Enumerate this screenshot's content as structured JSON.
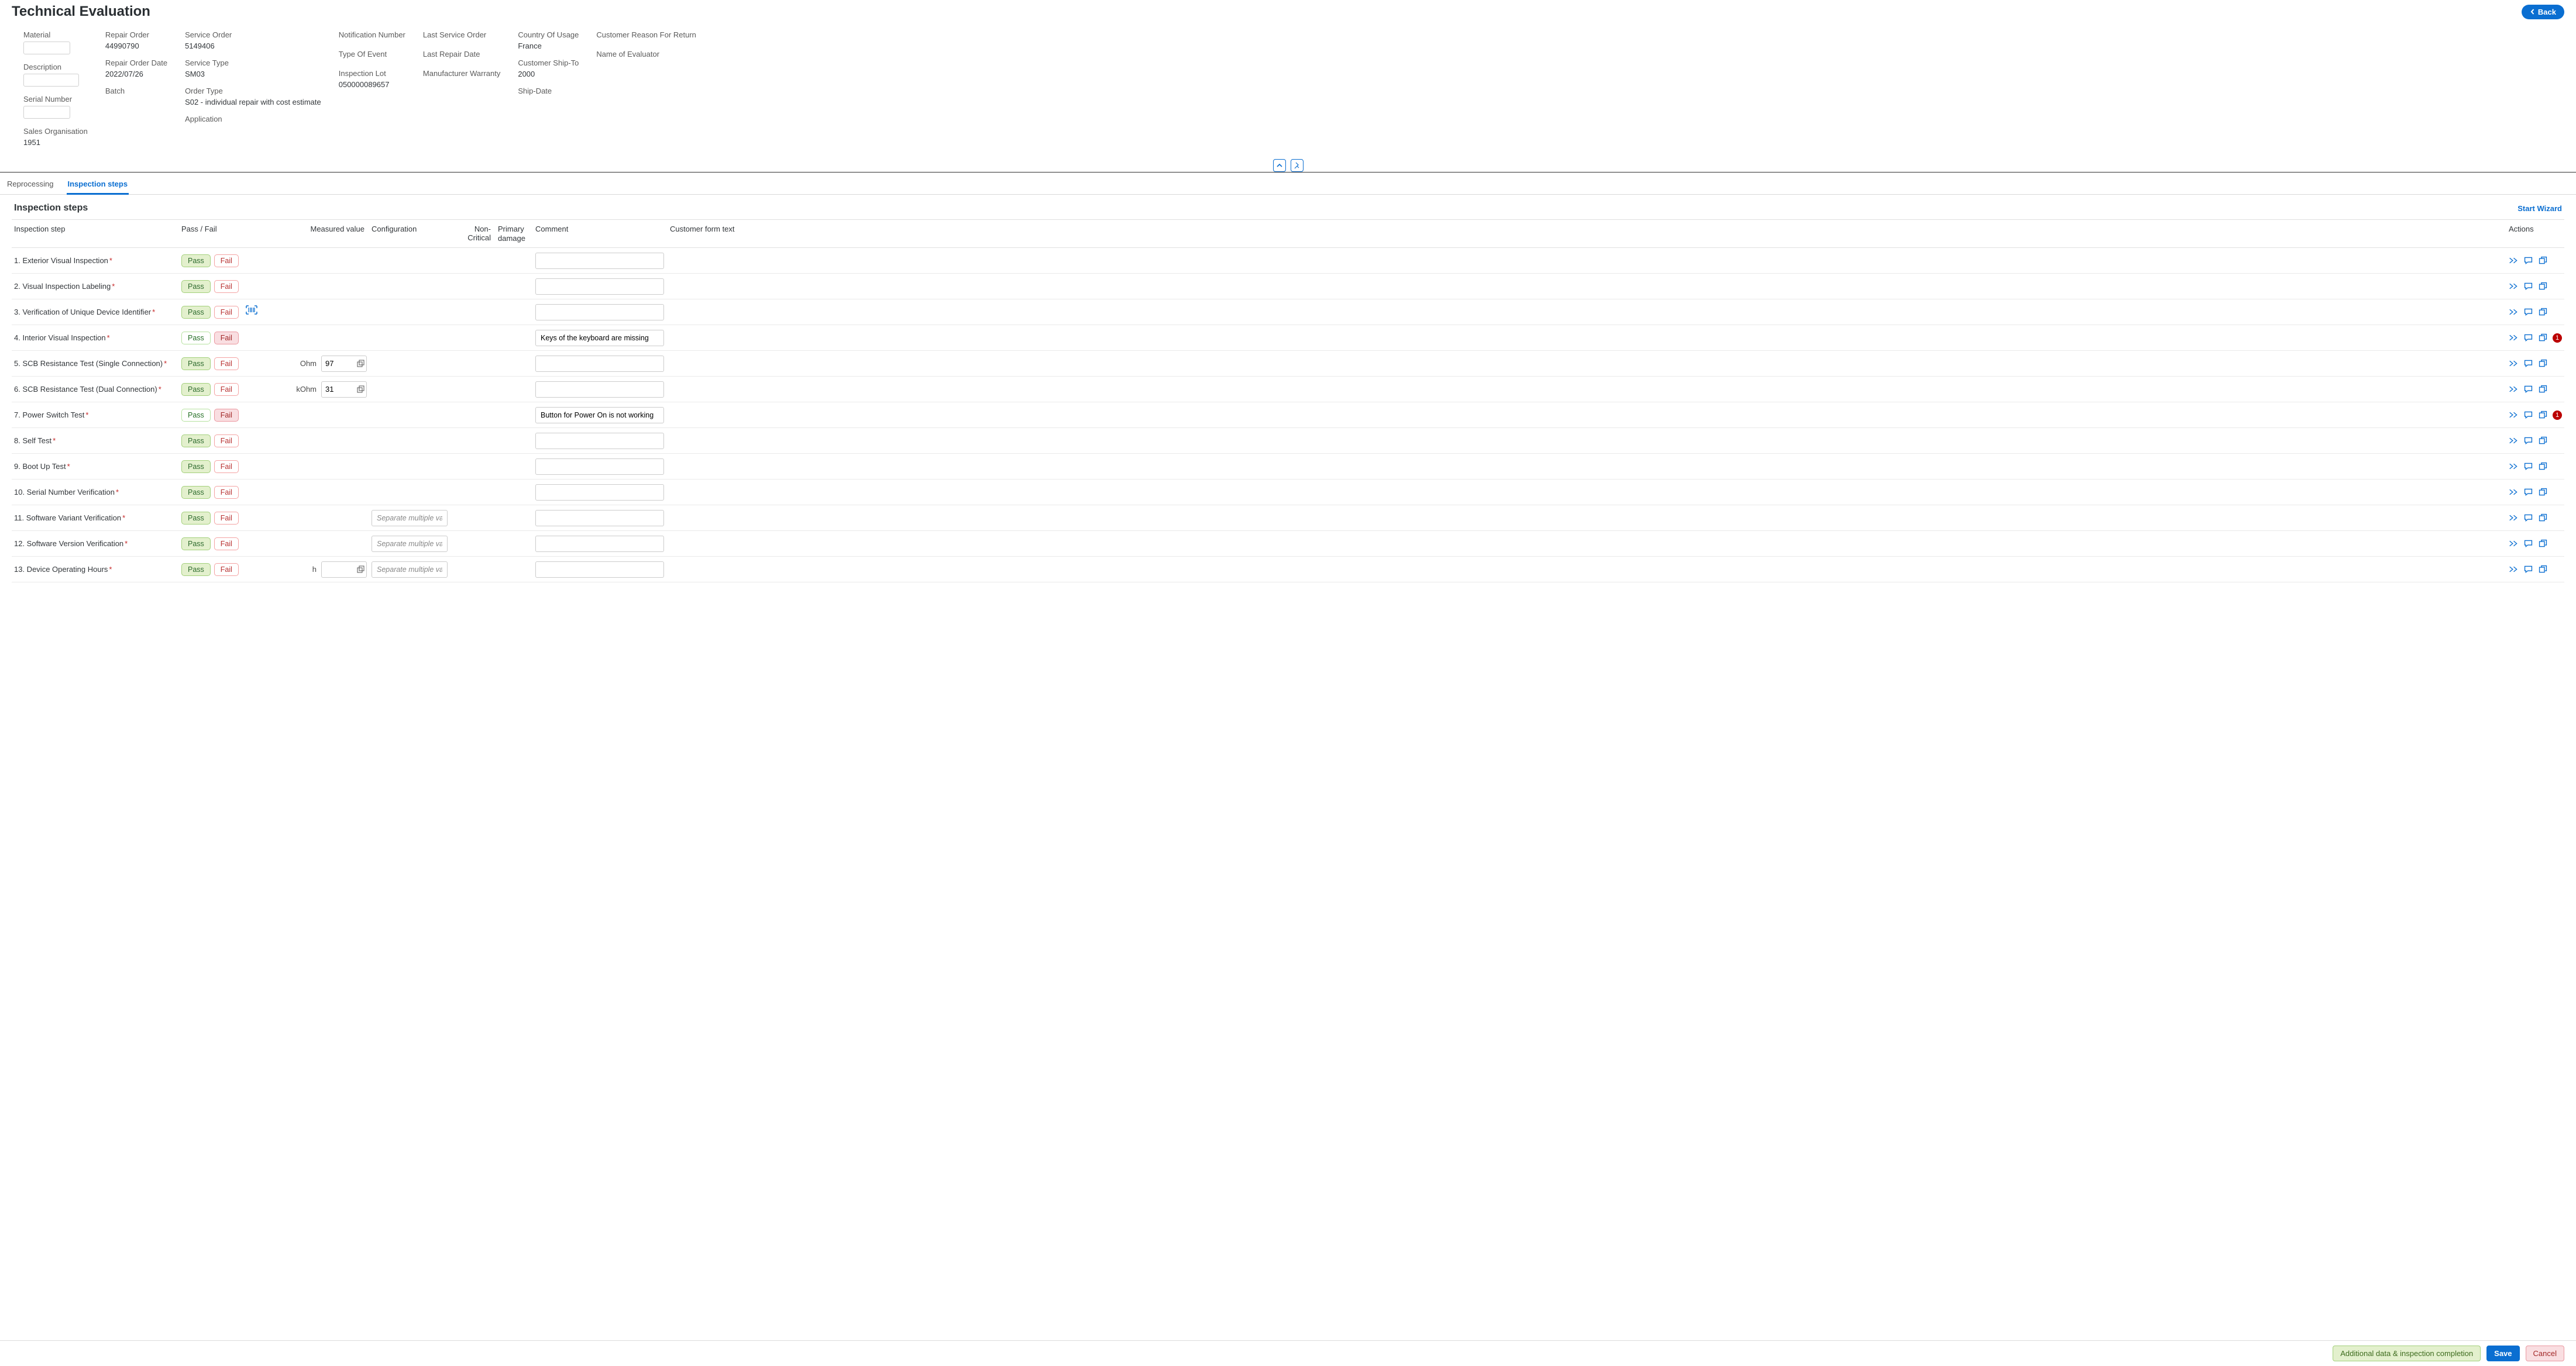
{
  "header": {
    "title": "Technical Evaluation",
    "back_label": "Back"
  },
  "details": {
    "col0": {
      "material_label": "Material",
      "description_label": "Description",
      "serial_number_label": "Serial Number",
      "sales_org_label": "Sales Organisation",
      "sales_org_value": "1951"
    },
    "col1": {
      "repair_order_label": "Repair Order",
      "repair_order_value": "44990790",
      "repair_order_date_label": "Repair Order Date",
      "repair_order_date_value": "2022/07/26",
      "batch_label": "Batch"
    },
    "col2": {
      "service_order_label": "Service Order",
      "service_order_value": "5149406",
      "service_type_label": "Service Type",
      "service_type_value": "SM03",
      "order_type_label": "Order Type",
      "order_type_value": "S02 - individual repair with cost estimate",
      "application_label": "Application"
    },
    "col3": {
      "notification_number_label": "Notification Number",
      "type_of_event_label": "Type Of Event",
      "inspection_lot_label": "Inspection Lot",
      "inspection_lot_value": "050000089657"
    },
    "col4": {
      "last_service_order_label": "Last Service Order",
      "last_repair_date_label": "Last Repair Date",
      "manufacturer_warranty_label": "Manufacturer Warranty"
    },
    "col5": {
      "country_usage_label": "Country Of Usage",
      "country_usage_value": "France",
      "customer_shipto_label": "Customer Ship-To",
      "customer_shipto_value": "2000",
      "ship_date_label": "Ship-Date"
    },
    "col6": {
      "customer_reason_label": "Customer Reason For Return",
      "evaluator_label": "Name of Evaluator"
    }
  },
  "tabs": {
    "reprocessing": "Reprocessing",
    "inspection_steps": "Inspection steps"
  },
  "section": {
    "title": "Inspection steps",
    "start_wizard": "Start Wizard"
  },
  "columns": {
    "step": "Inspection step",
    "pf": "Pass / Fail",
    "meas": "Measured value",
    "conf": "Configuration",
    "nc": "Non-Critical",
    "pd": "Primary damage",
    "comm": "Comment",
    "cft": "Customer form text",
    "act": "Actions"
  },
  "rows": [
    {
      "n": "1.",
      "name": "Exterior Visual Inspection",
      "result": "pass",
      "meas_unit": "",
      "meas_val": "",
      "conf_placeholder": "",
      "comment": "",
      "badge": "",
      "barcode": false
    },
    {
      "n": "2.",
      "name": "Visual Inspection Labeling",
      "result": "pass",
      "meas_unit": "",
      "meas_val": "",
      "conf_placeholder": "",
      "comment": "",
      "badge": "",
      "barcode": false
    },
    {
      "n": "3.",
      "name": "Verification of Unique Device Identifier",
      "result": "pass",
      "meas_unit": "",
      "meas_val": "",
      "conf_placeholder": "",
      "comment": "",
      "badge": "",
      "barcode": true
    },
    {
      "n": "4.",
      "name": "Interior Visual Inspection",
      "result": "fail",
      "meas_unit": "",
      "meas_val": "",
      "conf_placeholder": "",
      "comment": "Keys of the keyboard are missing",
      "badge": "1",
      "barcode": false
    },
    {
      "n": "5.",
      "name": "SCB Resistance Test (Single Connection)",
      "result": "pass",
      "meas_unit": "Ohm",
      "meas_val": "97",
      "conf_placeholder": "",
      "comment": "",
      "badge": "",
      "barcode": false
    },
    {
      "n": "6.",
      "name": "SCB Resistance Test (Dual Connection)",
      "result": "pass",
      "meas_unit": "kOhm",
      "meas_val": "31",
      "conf_placeholder": "",
      "comment": "",
      "badge": "",
      "barcode": false
    },
    {
      "n": "7.",
      "name": "Power Switch Test",
      "result": "fail",
      "meas_unit": "",
      "meas_val": "",
      "conf_placeholder": "",
      "comment": "Button for Power On is not working",
      "badge": "1",
      "barcode": false
    },
    {
      "n": "8.",
      "name": "Self Test",
      "result": "pass",
      "meas_unit": "",
      "meas_val": "",
      "conf_placeholder": "",
      "comment": "",
      "badge": "",
      "barcode": false
    },
    {
      "n": "9.",
      "name": "Boot Up Test",
      "result": "pass",
      "meas_unit": "",
      "meas_val": "",
      "conf_placeholder": "",
      "comment": "",
      "badge": "",
      "barcode": false
    },
    {
      "n": "10.",
      "name": "Serial Number Verification",
      "result": "pass",
      "meas_unit": "",
      "meas_val": "",
      "conf_placeholder": "",
      "comment": "",
      "badge": "",
      "barcode": false
    },
    {
      "n": "11.",
      "name": "Software Variant Verification",
      "result": "pass",
      "meas_unit": "",
      "meas_val": "",
      "conf_placeholder": "Separate multiple valu…",
      "comment": "",
      "badge": "",
      "barcode": false
    },
    {
      "n": "12.",
      "name": "Software Version Verification",
      "result": "pass",
      "meas_unit": "",
      "meas_val": "",
      "conf_placeholder": "Separate multiple valu…",
      "comment": "",
      "badge": "",
      "barcode": false
    },
    {
      "n": "13.",
      "name": "Device Operating Hours",
      "result": "pass",
      "meas_unit": "h",
      "meas_val": "",
      "conf_placeholder": "Separate multiple valu…",
      "comment": "",
      "badge": "",
      "barcode": false
    }
  ],
  "pf_labels": {
    "pass": "Pass",
    "fail": "Fail"
  },
  "footer": {
    "additional": "Additional data & inspection completion",
    "save": "Save",
    "cancel": "Cancel"
  }
}
